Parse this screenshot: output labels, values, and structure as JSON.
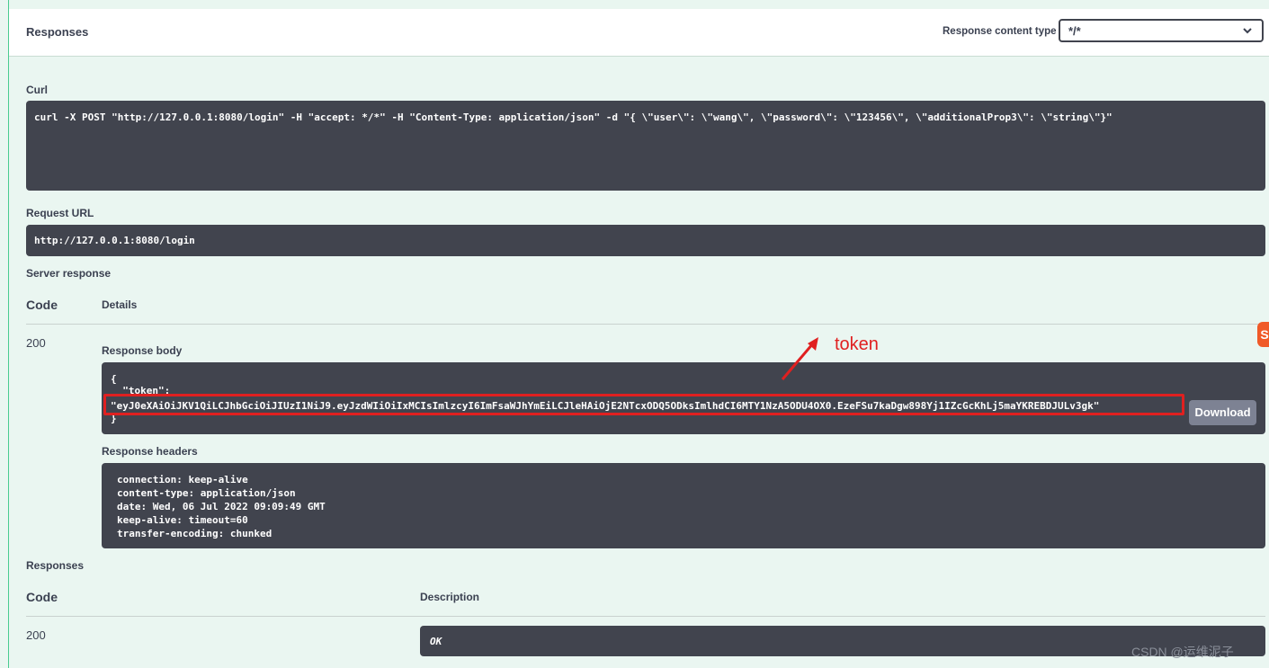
{
  "header": {
    "title": "Responses",
    "content_type_label": "Response content type",
    "content_type_value": "*/*"
  },
  "curl": {
    "label": "Curl",
    "command": "curl -X POST \"http://127.0.0.1:8080/login\" -H \"accept: */*\" -H \"Content-Type: application/json\" -d \"{ \\\"user\\\": \\\"wang\\\", \\\"password\\\": \\\"123456\\\", \\\"additionalProp3\\\": \\\"string\\\"}\""
  },
  "request_url": {
    "label": "Request URL",
    "value": "http://127.0.0.1:8080/login"
  },
  "server_response": {
    "label": "Server response",
    "col_code": "Code",
    "col_details": "Details",
    "code": "200",
    "body_label": "Response body",
    "body_lines": [
      "{",
      "  \"token\":",
      "\"eyJ0eXAiOiJKV1QiLCJhbGciOiJIUzI1NiJ9.eyJzdWIiOiIxMCIsImlzcyI6ImFsaWJhYmEiLCJleHAiOjE2NTcxODQ5ODksImlhdCI6MTY1NzA5ODU4OX0.EzeFSu7kaDgw898Yj1IZcGcKhLj5maYKREBDJULv3gk\"",
      "}"
    ],
    "download_label": "Download",
    "headers_label": "Response headers",
    "headers_lines": [
      "connection: keep-alive",
      "content-type: application/json",
      "date: Wed, 06 Jul 2022 09:09:49 GMT",
      "keep-alive: timeout=60",
      "transfer-encoding: chunked"
    ]
  },
  "responses": {
    "label": "Responses",
    "col_code": "Code",
    "col_description": "Description",
    "rows": [
      {
        "code": "200",
        "description": "OK"
      }
    ]
  },
  "annotation": {
    "text": "token",
    "color": "#e02020"
  },
  "side_badge": "S",
  "watermark": "CSDN @运维泥子",
  "colors": {
    "accent": "#49cc90",
    "code_bg": "#41444e",
    "highlight": "#e02020",
    "button": "#7d8293"
  }
}
